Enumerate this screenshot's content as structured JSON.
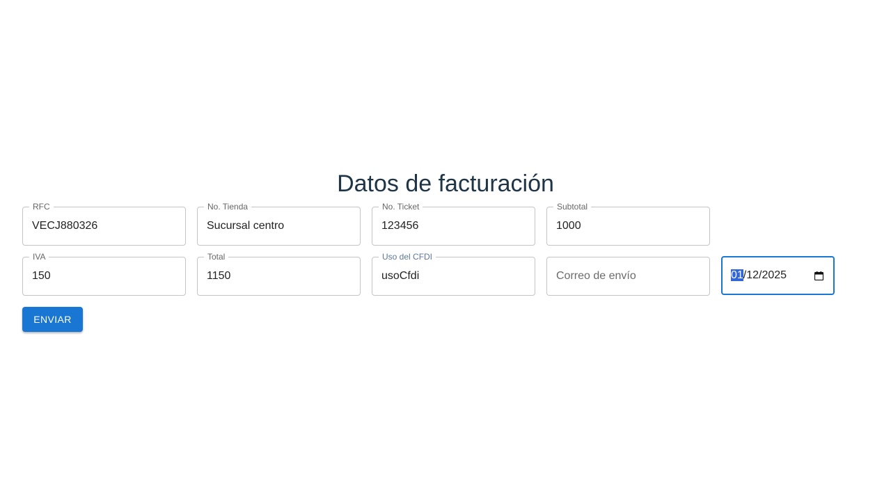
{
  "form": {
    "title": "Datos de facturación",
    "fields": {
      "rfc": {
        "label": "RFC",
        "value": "VECJ880326"
      },
      "tienda": {
        "label": "No. Tienda",
        "value": "Sucursal centro"
      },
      "ticket": {
        "label": "No. Ticket",
        "value": "123456"
      },
      "subtotal": {
        "label": "Subtotal",
        "value": "1000"
      },
      "iva": {
        "label": "IVA",
        "value": "150"
      },
      "total": {
        "label": "Total",
        "value": "1150"
      },
      "uso_cfdi": {
        "label": "Uso del CFDI",
        "value": "usoCfdi"
      },
      "correo": {
        "placeholder": "Correo de envío"
      },
      "fecha": {
        "day": "01",
        "rest": "/12/2025"
      }
    },
    "submit_label": "ENVIAR"
  },
  "colors": {
    "primary": "#1976d2",
    "title": "#1e3447",
    "border": "#c4c4c4",
    "selection": "#3367d6"
  },
  "icons": {
    "date_picker": "calendar-icon"
  }
}
